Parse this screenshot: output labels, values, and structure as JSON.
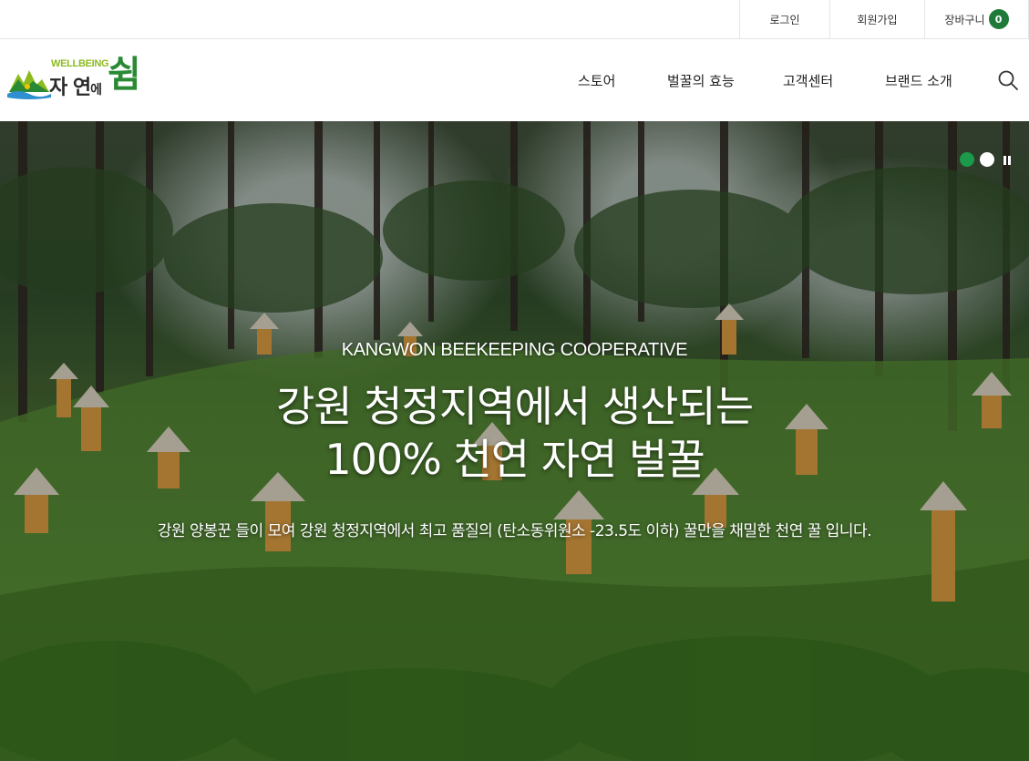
{
  "utility": {
    "login": "로그인",
    "join": "회원가입",
    "cart": "장바구니",
    "cart_count": "0"
  },
  "logo": {
    "sub": "WELLBEING",
    "main_a": "자 연",
    "main_b": "에",
    "big": "쉼"
  },
  "nav": {
    "store": "스토어",
    "effect": "벌꿀의 효능",
    "cs": "고객센터",
    "brand": "브랜드 소개"
  },
  "hero": {
    "eyebrow": "KANGWON BEEKEEPING COOPERATIVE",
    "title_line1": "강원 청정지역에서 생산되는",
    "title_line2": "100% 천연 자연 벌꿀",
    "desc": "강원 양봉꾼 들이 모여 강원 청정지역에서 최고 품질의 (탄소동위원소 -23.5도 이하) 꿀만을 채밀한 천연 꿀 입니다."
  },
  "colors": {
    "accent": "#1f7a3a",
    "active_dot": "#1a9a4a",
    "logo_green": "#2a8a34",
    "logo_lime": "#8dba1f"
  },
  "icons": {
    "search": "search-icon",
    "pause": "pause-icon"
  }
}
